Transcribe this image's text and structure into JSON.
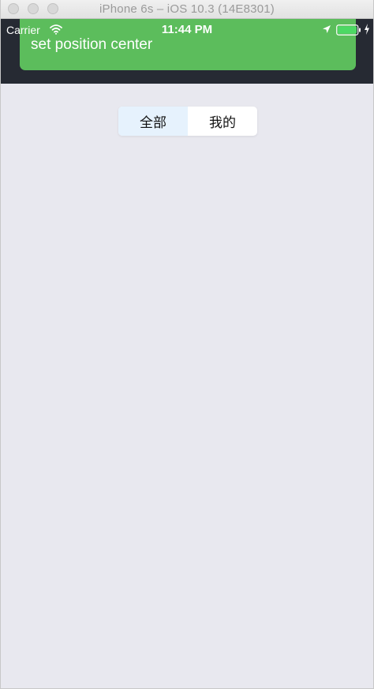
{
  "window": {
    "title": "iPhone 6s – iOS 10.3 (14E8301)"
  },
  "statusbar": {
    "carrier": "Carrier",
    "time": "11:44 PM",
    "icons": [
      "wifi-icon",
      "location-icon",
      "battery-icon",
      "charging-bolt-icon"
    ],
    "battery_color": "#4cd964"
  },
  "toast": {
    "message": "set position center",
    "color": "#5cbd5c"
  },
  "segmented_control": {
    "selected": "全部",
    "segments": [
      {
        "label": "全部"
      },
      {
        "label": "我的"
      }
    ],
    "active_background": "#e6f2fd"
  },
  "colors": {
    "page_background": "#e8e8ef",
    "header_dark": "#262a33"
  }
}
